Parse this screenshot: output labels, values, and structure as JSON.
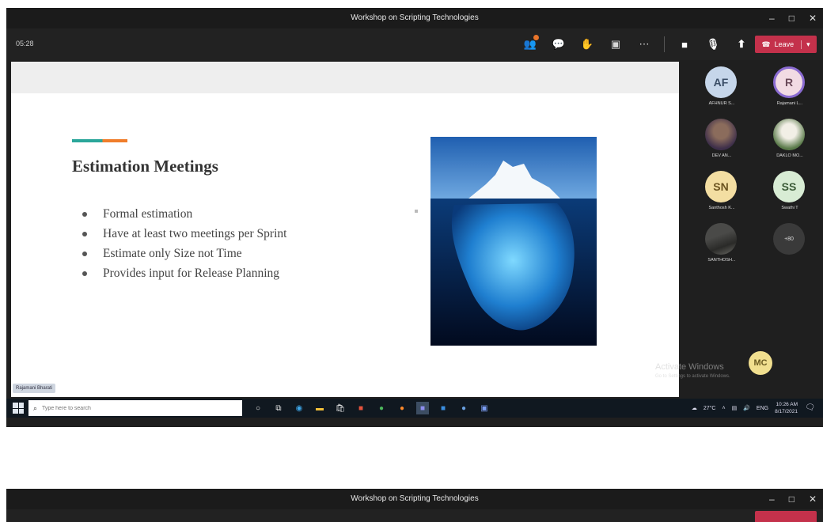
{
  "window": {
    "title": "Workshop on Scripting Technologies",
    "controls": [
      "–",
      "□",
      "✕"
    ]
  },
  "toolbar": {
    "timer": "05:28",
    "icons": [
      "people-icon",
      "chat-icon",
      "reactions-icon",
      "rooms-icon",
      "more-icon",
      "camera-icon",
      "mic-icon",
      "share-icon"
    ],
    "leave_label": "Leave",
    "leave_color": "#c4314b"
  },
  "slide": {
    "title": "Estimation Meetings",
    "bullets": [
      "Formal estimation",
      "Have at least two meetings per Sprint",
      "Estimate only Size not Time",
      "Provides input for Release Planning"
    ],
    "accent_colors": [
      "#2aa69a",
      "#f07d2a"
    ]
  },
  "presenter_tag": "Rajamani Bharati",
  "participants": [
    {
      "initials": "AF",
      "name": "AFHNUR S...",
      "type": "initials"
    },
    {
      "initials": "R",
      "name": "Rajamani L...",
      "type": "initials"
    },
    {
      "initials": "",
      "name": "DEV AN...",
      "type": "photo"
    },
    {
      "initials": "",
      "name": "DAKLO MO...",
      "type": "photo"
    },
    {
      "initials": "SN",
      "name": "Santhosh K...",
      "type": "initials"
    },
    {
      "initials": "SS",
      "name": "Swathi T",
      "type": "initials"
    },
    {
      "initials": "",
      "name": "SANTHOSH...",
      "type": "photo"
    },
    {
      "initials": "+80",
      "name": "",
      "type": "more"
    }
  ],
  "speaker_mc": "MC",
  "watermark": {
    "line1": "Activate Windows",
    "line2": "Go to Settings to activate Windows."
  },
  "taskbar": {
    "search_placeholder": "Type here to search",
    "weather": "27°C",
    "clock_time": "10:26 AM",
    "clock_date": "8/17/2021",
    "lang": "ENG"
  },
  "second_window": {
    "title": "Workshop on Scripting Technologies"
  }
}
